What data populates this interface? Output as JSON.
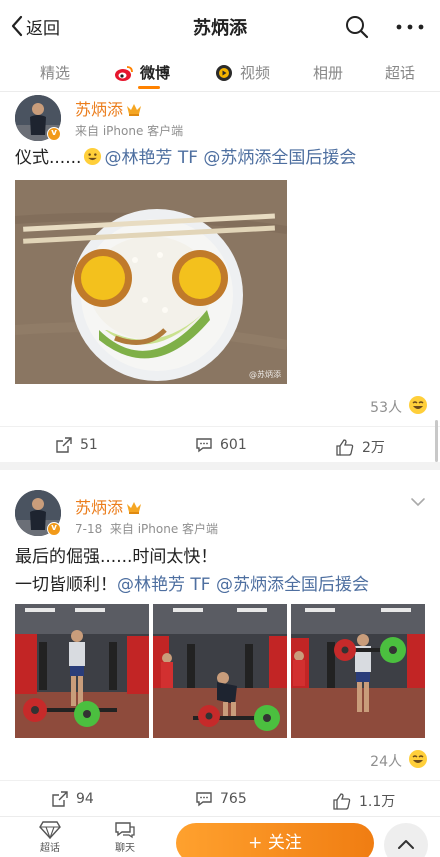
{
  "header": {
    "back_label": "返回",
    "title": "苏炳添"
  },
  "tabs": [
    {
      "label": "精选"
    },
    {
      "label": "微博"
    },
    {
      "label": "视频"
    },
    {
      "label": "相册"
    },
    {
      "label": "超话"
    }
  ],
  "posts": [
    {
      "author": "苏炳添",
      "meta": "来自 iPhone 客户端",
      "text_prefix": "仪式......",
      "mentions": [
        "@林艳芳 TF",
        "@苏炳添全国后援会"
      ],
      "watermark": "@苏炳添",
      "likes_people": "53人",
      "reposts": "51",
      "comments": "601",
      "likes": "2万"
    },
    {
      "author": "苏炳添",
      "date": "7-18",
      "meta": "来自 iPhone 客户端",
      "line1": "最后的倔强......时间太快！",
      "line2_prefix": "一切皆顺利！",
      "mentions": [
        "@林艳芳 TF",
        "@苏炳添全国后援会"
      ],
      "likes_people": "24人",
      "reposts": "94",
      "comments": "765",
      "likes": "1.1万"
    }
  ],
  "bottom": {
    "supertopic_label": "超话",
    "chat_label": "聊天",
    "follow_label": "+ 关注"
  },
  "colors": {
    "accent": "#ff8200",
    "name": "#eb7d1c",
    "mention": "#4e6fa0",
    "follow_start": "#ffa12e",
    "follow_end": "#f07d12"
  }
}
